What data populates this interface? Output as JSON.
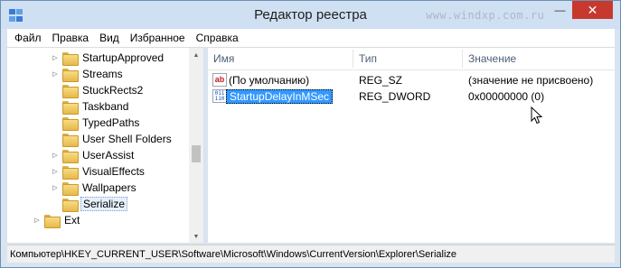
{
  "window": {
    "title": "Редактор реестра",
    "watermark": "www.windxp.com.ru",
    "minimize": "—",
    "close": "✕"
  },
  "menu": [
    "Файл",
    "Правка",
    "Вид",
    "Избранное",
    "Справка"
  ],
  "tree": [
    {
      "label": "StartupApproved",
      "expandable": true
    },
    {
      "label": "Streams",
      "expandable": true
    },
    {
      "label": "StuckRects2",
      "expandable": false
    },
    {
      "label": "Taskband",
      "expandable": false
    },
    {
      "label": "TypedPaths",
      "expandable": false
    },
    {
      "label": "User Shell Folders",
      "expandable": false
    },
    {
      "label": "UserAssist",
      "expandable": true
    },
    {
      "label": "VisualEffects",
      "expandable": true
    },
    {
      "label": "Wallpapers",
      "expandable": true
    },
    {
      "label": "Serialize",
      "expandable": false,
      "selected": true
    },
    {
      "label": "Ext",
      "expandable": true
    }
  ],
  "columns": {
    "name": "Имя",
    "type": "Тип",
    "value": "Значение"
  },
  "rows": [
    {
      "name": "(По умолчанию)",
      "type": "REG_SZ",
      "value": "(значение не присвоено)",
      "icon": "string-value-icon",
      "icon_text": "ab"
    },
    {
      "name": "StartupDelayInMSec",
      "type": "REG_DWORD",
      "value": "0x00000000 (0)",
      "icon": "dword-value-icon",
      "icon_text": "011 110",
      "selected": true
    }
  ],
  "status": "Компьютер\\HKEY_CURRENT_USER\\Software\\Microsoft\\Windows\\CurrentVersion\\Explorer\\Serialize",
  "colors": {
    "selection": "#3399ff",
    "titlebar": "#cfe0f2",
    "close": "#c7392f"
  }
}
